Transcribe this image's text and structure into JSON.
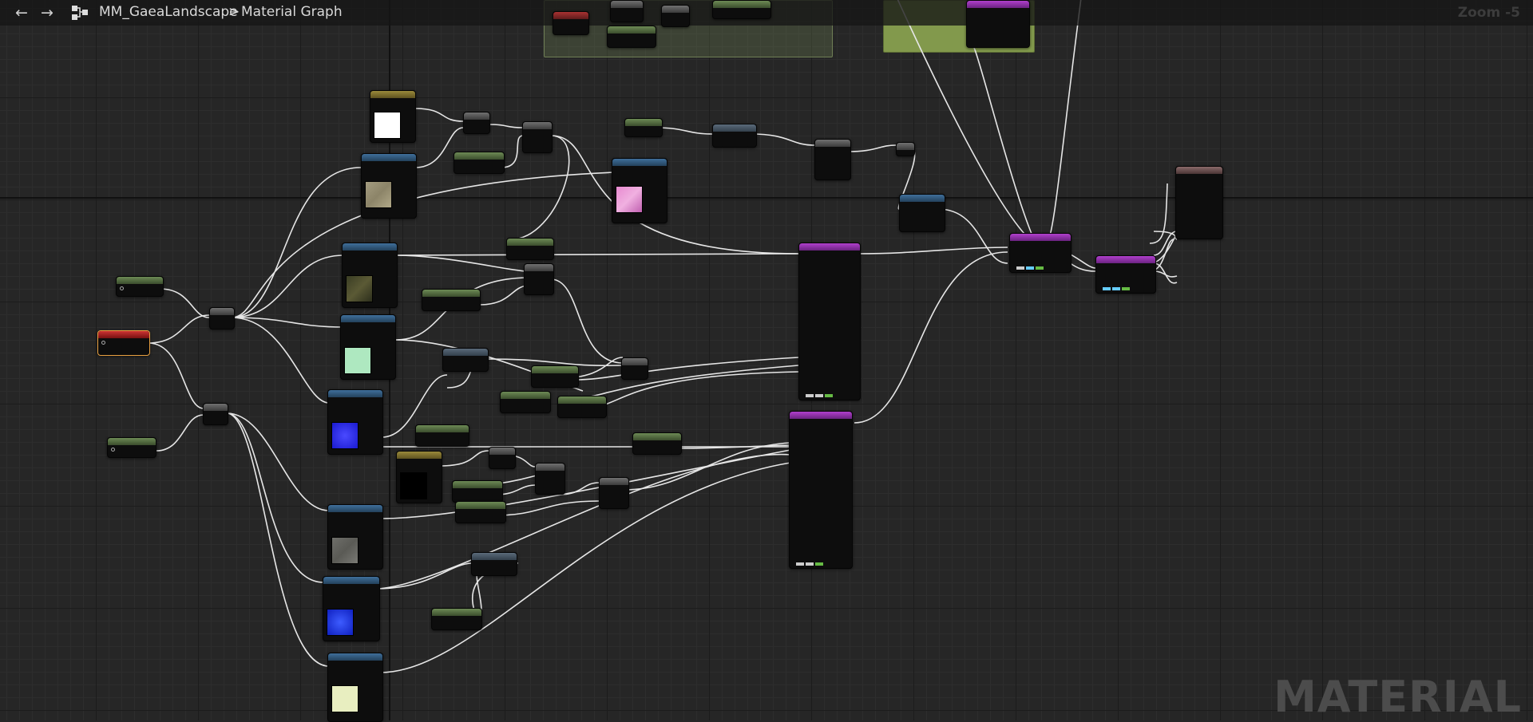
{
  "toolbar": {
    "back_icon": "arrow-left-icon",
    "forward_icon": "arrow-right-icon",
    "graph_icon": "material-graph-icon",
    "asset_name": "MM_GaeaLandscape",
    "separator": ">",
    "graph_name": "Material Graph",
    "zoom_label": "Zoom -5"
  },
  "watermark": "MATERIAL",
  "colors": {
    "canvas": "#262626",
    "wire": "#e8e8e8",
    "constant_node": "#5c7a45",
    "texture_node": "#2f5a80",
    "substrate_node": "#9b36b6",
    "comment_green": "#7f9b48"
  }
}
